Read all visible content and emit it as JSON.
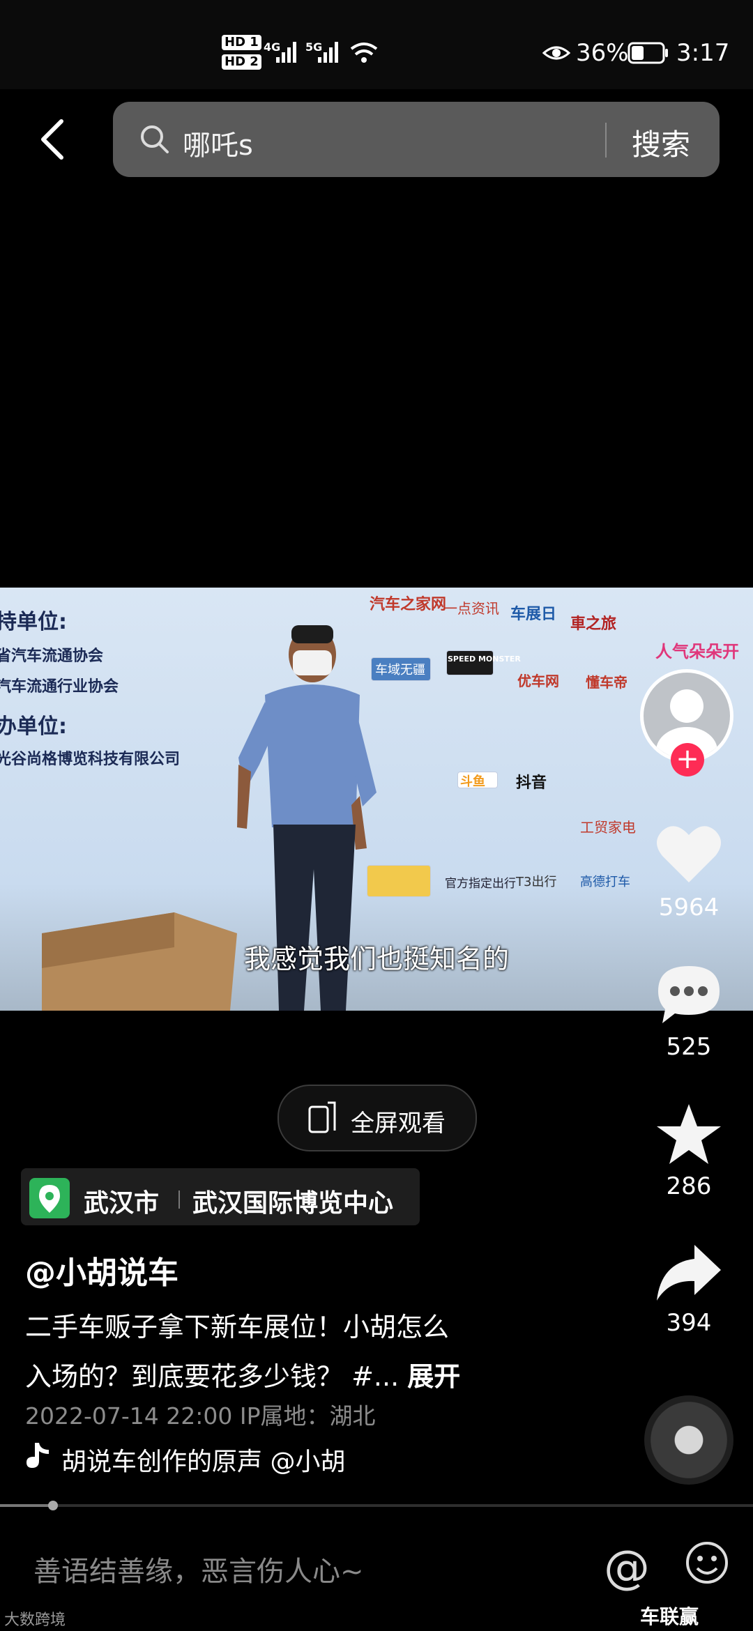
{
  "status_bar": {
    "hd1": "HD 1",
    "hd2": "HD 2",
    "net1": "4G",
    "net2": "5G",
    "battery": "36%",
    "time": "3:17"
  },
  "search": {
    "query": "哪吒s",
    "button": "搜索"
  },
  "video": {
    "banner_left": [
      "持单位:",
      "省汽车流通协会",
      "汽车流通行业协会",
      "办单位:",
      "光谷尚格博览科技有限公司"
    ],
    "logos": [
      "汽车之家网",
      "一点资讯",
      "车展日",
      "車之旅",
      "SPEED MONSTER",
      "车域无疆",
      "优车网",
      "懂车帝",
      "斗鱼",
      "抖音",
      "工贸家电",
      "官方指定出行",
      "T3出行",
      "高德打车",
      "人气朵朵开"
    ],
    "subtitle": "我感觉我们也挺知名的"
  },
  "rail": {
    "likes": "5964",
    "comments": "525",
    "favorites": "286",
    "shares": "394"
  },
  "fullscreen_label": "全屏观看",
  "location": {
    "city": "武汉市",
    "venue": "武汉国际博览中心"
  },
  "caption": {
    "author": "@小胡说车",
    "line1": "二手车贩子拿下新车展位！小胡怎么",
    "line2": "入场的？到底要花多少钱？ #...",
    "expand": "展开",
    "meta": "2022-07-14 22:00  IP属地：湖北",
    "music": "胡说车创作的原声    @小胡"
  },
  "comment_bar": {
    "placeholder": "善语结善缘，恶言伤人心~",
    "at": "@"
  },
  "watermarks": {
    "left": "大数跨境",
    "right": "车联赢"
  },
  "progress_fraction": 0.07
}
